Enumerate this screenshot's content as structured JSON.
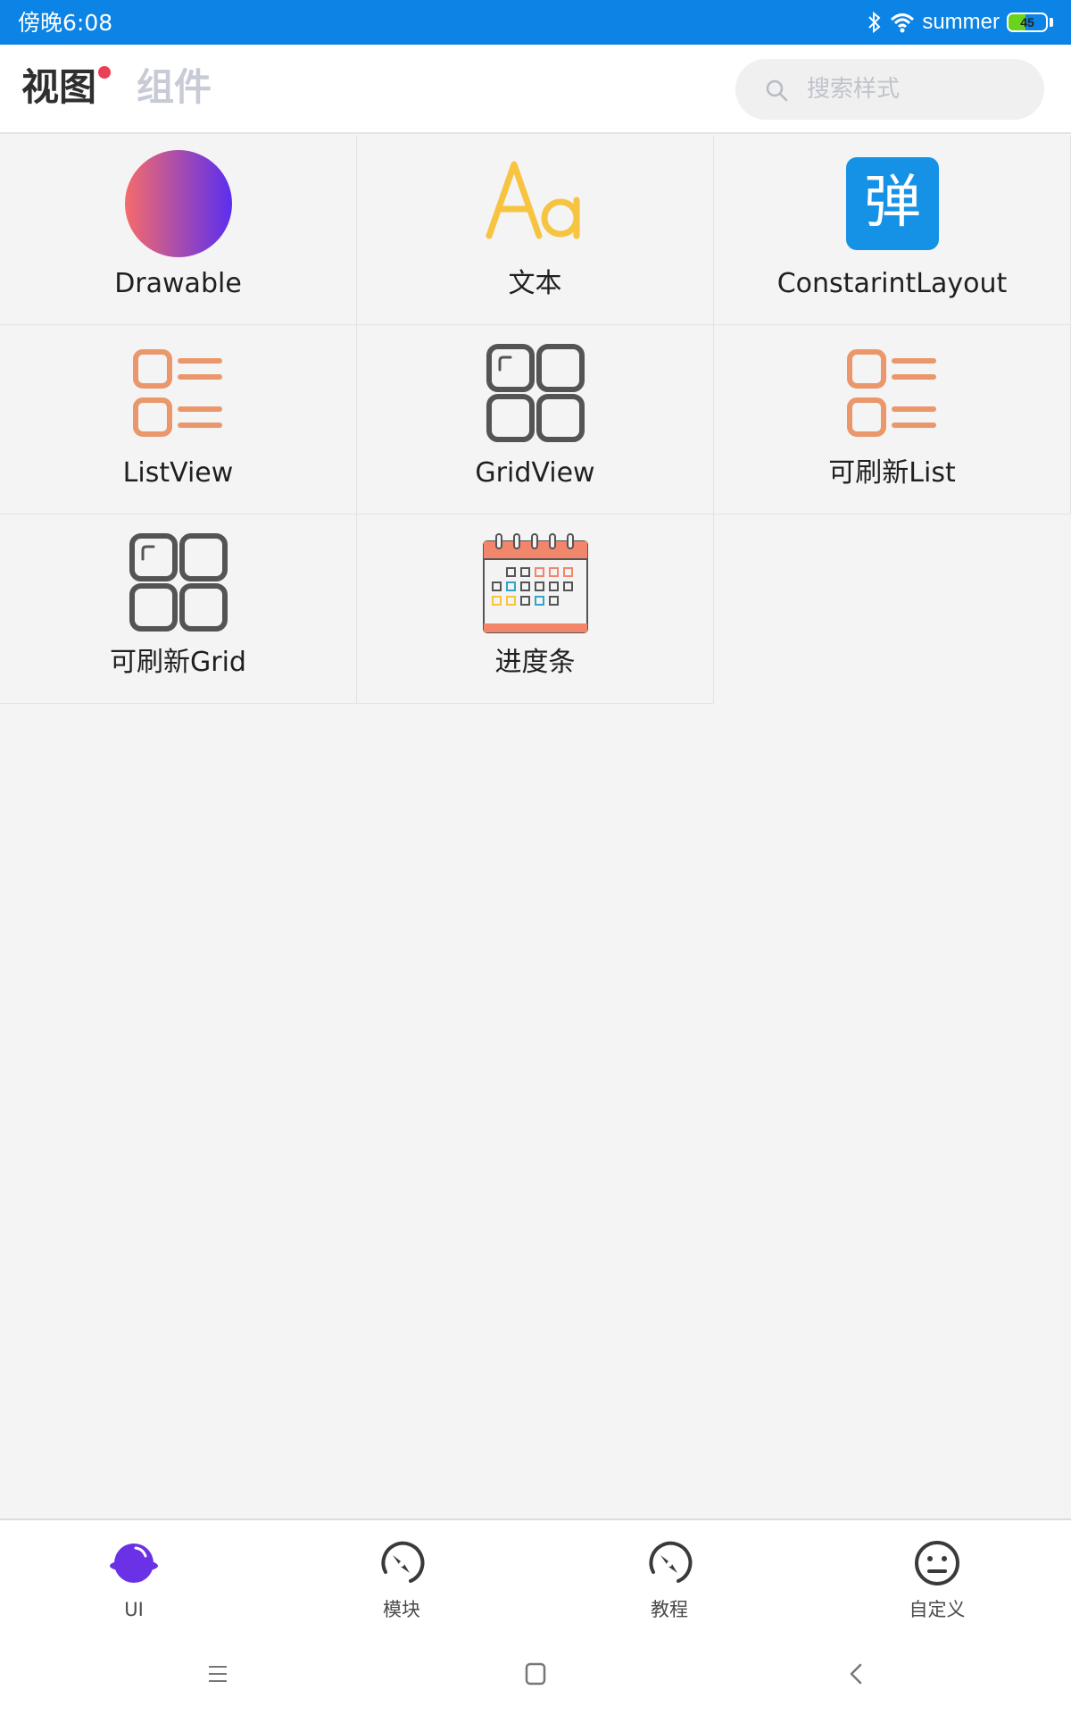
{
  "status_bar": {
    "time": "傍晚6:08",
    "network_name": "summer",
    "battery_level": 45,
    "battery_label": "45",
    "icons": [
      "bluetooth-icon",
      "wifi-icon",
      "battery-icon"
    ]
  },
  "header": {
    "tabs": [
      {
        "label": "视图",
        "active": true,
        "has_badge": true
      },
      {
        "label": "组件",
        "active": false
      }
    ],
    "search": {
      "placeholder": "搜索样式",
      "icon": "search-icon"
    }
  },
  "grid": {
    "items": [
      {
        "label": "Drawable",
        "icon": "gradient-circle-icon"
      },
      {
        "label": "文本",
        "icon": "font-aa-icon"
      },
      {
        "label": "ConstarintLayout",
        "icon": "dialog-char-icon",
        "icon_text": "弹"
      },
      {
        "label": "ListView",
        "icon": "list-icon"
      },
      {
        "label": "GridView",
        "icon": "grid-icon"
      },
      {
        "label": "可刷新List",
        "icon": "list-icon"
      },
      {
        "label": "可刷新Grid",
        "icon": "grid-icon"
      },
      {
        "label": "进度条",
        "icon": "calendar-icon"
      }
    ]
  },
  "bottom_nav": {
    "items": [
      {
        "label": "UI",
        "icon": "planet-icon",
        "active": true
      },
      {
        "label": "模块",
        "icon": "compass-icon",
        "active": false
      },
      {
        "label": "教程",
        "icon": "compass-icon",
        "active": false
      },
      {
        "label": "自定义",
        "icon": "face-icon",
        "active": false
      }
    ]
  },
  "system_nav": {
    "buttons": [
      "menu-icon",
      "home-icon",
      "back-icon"
    ]
  },
  "colors": {
    "status_bar": "#0b84e6",
    "accent_purple": "#6a31e6",
    "text_gray": "#4a4a4a",
    "grid_orange": "#e9976b",
    "grid_dark": "#545454",
    "badge_red": "#ea3f54"
  }
}
